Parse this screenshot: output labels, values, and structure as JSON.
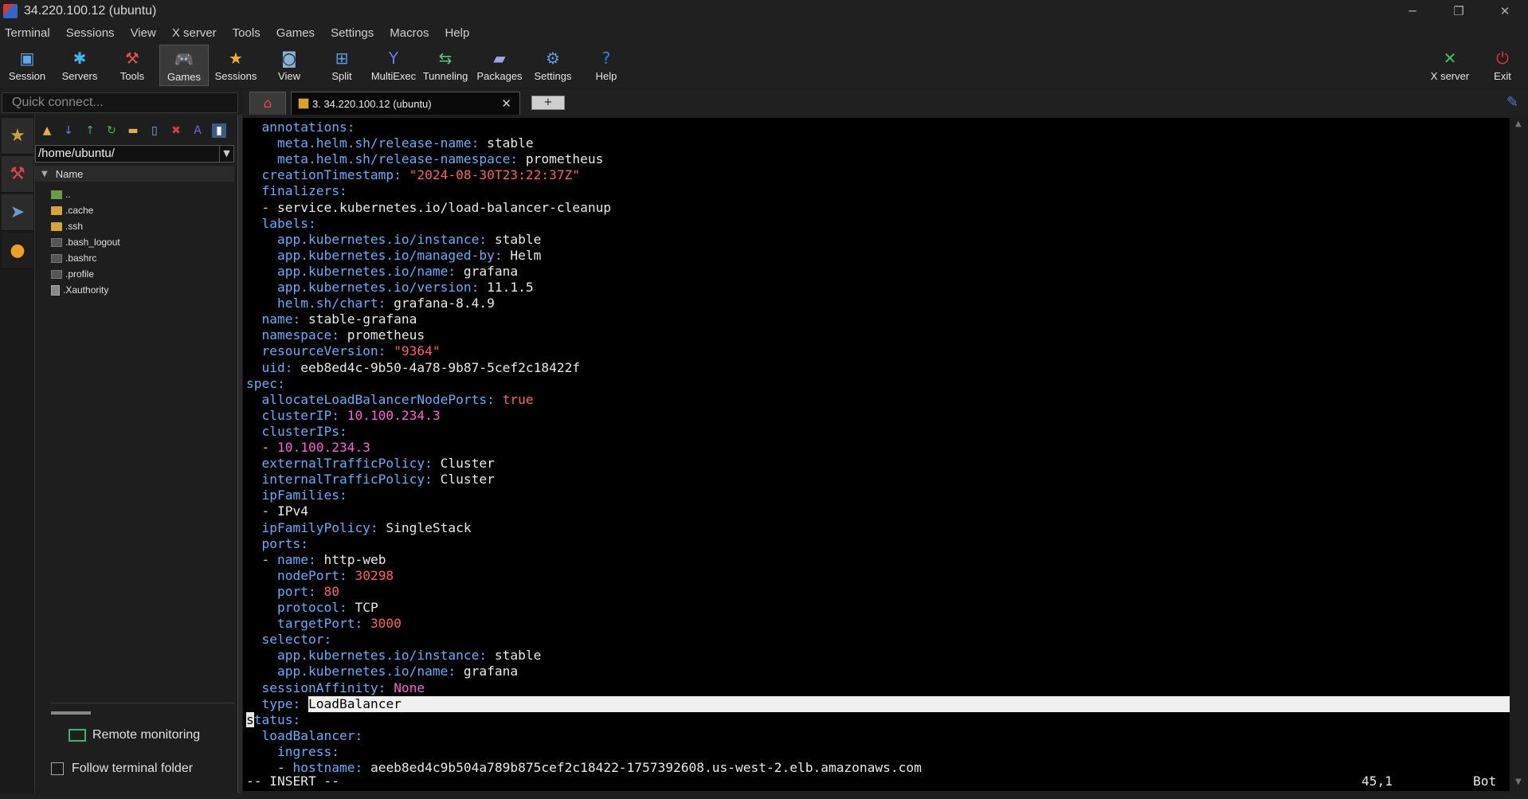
{
  "window": {
    "title": "34.220.100.12 (ubuntu)",
    "minimize_glyph": "─",
    "restore_glyph": "❐",
    "close_glyph": "✕"
  },
  "menu": [
    "Terminal",
    "Sessions",
    "View",
    "X server",
    "Tools",
    "Games",
    "Settings",
    "Macros",
    "Help"
  ],
  "toolbar": {
    "tools": [
      {
        "label": "Session",
        "icon": "session-icon",
        "glyph": "▣",
        "color": "#5fa8e8"
      },
      {
        "label": "Servers",
        "icon": "servers-icon",
        "glyph": "✱",
        "color": "#4ab0e8"
      },
      {
        "label": "Tools",
        "icon": "tools-icon",
        "glyph": "⚒",
        "color": "#e85050"
      },
      {
        "label": "Games",
        "icon": "games-icon",
        "glyph": "🎮",
        "color": "#dddddd"
      },
      {
        "label": "Sessions",
        "icon": "star-icon",
        "glyph": "★",
        "color": "#f0b020"
      },
      {
        "label": "View",
        "icon": "view-icon",
        "glyph": "◙",
        "color": "#8ab0d8"
      },
      {
        "label": "Split",
        "icon": "split-icon",
        "glyph": "⊞",
        "color": "#5a9ae0"
      },
      {
        "label": "MultiExec",
        "icon": "multiexec-icon",
        "glyph": "Y",
        "color": "#6a7ae8"
      },
      {
        "label": "Tunneling",
        "icon": "tunneling-icon",
        "glyph": "⇆",
        "color": "#5ac080"
      },
      {
        "label": "Packages",
        "icon": "packages-icon",
        "glyph": "▰",
        "color": "#9aa8e8"
      },
      {
        "label": "Settings",
        "icon": "gear-icon",
        "glyph": "⚙",
        "color": "#5a9ae0"
      },
      {
        "label": "Help",
        "icon": "help-icon",
        "glyph": "?",
        "color": "#2a8ae8"
      }
    ],
    "right_tools": [
      {
        "label": "X server",
        "icon": "x-server-icon",
        "glyph": "✕",
        "color": "#40c060"
      },
      {
        "label": "Exit",
        "icon": "power-icon",
        "glyph": "⏻",
        "color": "#e83030"
      }
    ]
  },
  "quick_connect": {
    "placeholder": "Quick connect..."
  },
  "tabs": {
    "home_glyph": "⌂",
    "active_label": "3. 34.220.100.12 (ubuntu)",
    "close_glyph": "✕",
    "new_glyph": "+",
    "attach_glyph": "✎"
  },
  "vertical_tabs": [
    {
      "name": "star-icon",
      "glyph": "★",
      "color": "#c8a040"
    },
    {
      "name": "tools-icon",
      "glyph": "⚒",
      "color": "#e04848"
    },
    {
      "name": "send-icon",
      "glyph": "➤",
      "color": "#6a9ac8"
    },
    {
      "name": "sftp-icon",
      "glyph": "●",
      "color": "#f0a020"
    }
  ],
  "sidebar": {
    "toolbar_icons": [
      {
        "name": "folder-up-icon",
        "glyph": "▲",
        "color": "#e0b040"
      },
      {
        "name": "download-icon",
        "glyph": "↓",
        "color": "#4a90d8"
      },
      {
        "name": "upload-icon",
        "glyph": "↑",
        "color": "#40b070"
      },
      {
        "name": "refresh-icon",
        "glyph": "↻",
        "color": "#40c040"
      },
      {
        "name": "new-folder-icon",
        "glyph": "▬",
        "color": "#e0b040"
      },
      {
        "name": "new-file-icon",
        "glyph": "▯",
        "color": "#8ab0e0"
      },
      {
        "name": "delete-icon",
        "glyph": "✖",
        "color": "#d04040"
      },
      {
        "name": "rename-icon",
        "glyph": "A",
        "color": "#6a6ae0"
      },
      {
        "name": "view-toggle-icon",
        "glyph": "▮",
        "color": "#ffffff"
      }
    ],
    "path": "/home/ubuntu/",
    "column_header": "Name",
    "files": [
      {
        "name": "..",
        "kind": "up"
      },
      {
        "name": ".cache",
        "kind": "folder"
      },
      {
        "name": ".ssh",
        "kind": "folder"
      },
      {
        "name": ".bash_logout",
        "kind": "file"
      },
      {
        "name": ".bashrc",
        "kind": "file"
      },
      {
        "name": ".profile",
        "kind": "file"
      },
      {
        "name": ".Xauthority",
        "kind": "doc"
      }
    ],
    "remote_monitoring": "Remote monitoring",
    "follow_terminal": "Follow terminal folder"
  },
  "terminal": {
    "lines": [
      [
        [
          "k",
          "  annotations:"
        ]
      ],
      [
        [
          "k",
          "    meta.helm.sh/release-name:"
        ],
        [
          "v",
          " stable"
        ]
      ],
      [
        [
          "k",
          "    meta.helm.sh/release-namespace:"
        ],
        [
          "v",
          " prometheus"
        ]
      ],
      [
        [
          "k",
          "  creationTimestamp:"
        ],
        [
          "v",
          " "
        ],
        [
          "s",
          "\"2024-08-30T23:22:37Z\""
        ]
      ],
      [
        [
          "k",
          "  finalizers:"
        ]
      ],
      [
        [
          "dash",
          "  -"
        ],
        [
          "v",
          " service.kubernetes.io/load-balancer-cleanup"
        ]
      ],
      [
        [
          "k",
          "  labels:"
        ]
      ],
      [
        [
          "k",
          "    app.kubernetes.io/instance:"
        ],
        [
          "v",
          " stable"
        ]
      ],
      [
        [
          "k",
          "    app.kubernetes.io/managed-by:"
        ],
        [
          "v",
          " Helm"
        ]
      ],
      [
        [
          "k",
          "    app.kubernetes.io/name:"
        ],
        [
          "v",
          " grafana"
        ]
      ],
      [
        [
          "k",
          "    app.kubernetes.io/version:"
        ],
        [
          "v",
          " 11.1.5"
        ]
      ],
      [
        [
          "k",
          "    helm.sh/chart:"
        ],
        [
          "v",
          " grafana-8.4.9"
        ]
      ],
      [
        [
          "k",
          "  name:"
        ],
        [
          "v",
          " stable-grafana"
        ]
      ],
      [
        [
          "k",
          "  namespace:"
        ],
        [
          "v",
          " prometheus"
        ]
      ],
      [
        [
          "k",
          "  resourceVersion:"
        ],
        [
          "v",
          " "
        ],
        [
          "s",
          "\"9364\""
        ]
      ],
      [
        [
          "k",
          "  uid:"
        ],
        [
          "v",
          " eeb8ed4c-9b50-4a78-9b87-5cef2c18422f"
        ]
      ],
      [
        [
          "k",
          "spec:"
        ]
      ],
      [
        [
          "k",
          "  allocateLoadBalancerNodePorts:"
        ],
        [
          "v",
          " "
        ],
        [
          "s",
          "true"
        ]
      ],
      [
        [
          "k",
          "  clusterIP:"
        ],
        [
          "v",
          " "
        ],
        [
          "n",
          "10.100.234.3"
        ]
      ],
      [
        [
          "k",
          "  clusterIPs:"
        ]
      ],
      [
        [
          "dash",
          "  -"
        ],
        [
          "v",
          " "
        ],
        [
          "n",
          "10.100.234.3"
        ]
      ],
      [
        [
          "k",
          "  externalTrafficPolicy:"
        ],
        [
          "v",
          " Cluster"
        ]
      ],
      [
        [
          "k",
          "  internalTrafficPolicy:"
        ],
        [
          "v",
          " Cluster"
        ]
      ],
      [
        [
          "k",
          "  ipFamilies:"
        ]
      ],
      [
        [
          "dash",
          "  -"
        ],
        [
          "v",
          " IPv4"
        ]
      ],
      [
        [
          "k",
          "  ipFamilyPolicy:"
        ],
        [
          "v",
          " SingleStack"
        ]
      ],
      [
        [
          "k",
          "  ports:"
        ]
      ],
      [
        [
          "dash",
          "  -"
        ],
        [
          "k",
          " name:"
        ],
        [
          "v",
          " http-web"
        ]
      ],
      [
        [
          "k",
          "    nodePort:"
        ],
        [
          "v",
          " "
        ],
        [
          "s",
          "30298"
        ]
      ],
      [
        [
          "k",
          "    port:"
        ],
        [
          "v",
          " "
        ],
        [
          "s",
          "80"
        ]
      ],
      [
        [
          "k",
          "    protocol:"
        ],
        [
          "v",
          " TCP"
        ]
      ],
      [
        [
          "k",
          "    targetPort:"
        ],
        [
          "v",
          " "
        ],
        [
          "s",
          "3000"
        ]
      ],
      [
        [
          "k",
          "  selector:"
        ]
      ],
      [
        [
          "k",
          "    app.kubernetes.io/instance:"
        ],
        [
          "v",
          " stable"
        ]
      ],
      [
        [
          "k",
          "    app.kubernetes.io/name:"
        ],
        [
          "v",
          " grafana"
        ]
      ],
      [
        [
          "k",
          "  sessionAffinity:"
        ],
        [
          "v",
          " "
        ],
        [
          "n",
          "None"
        ]
      ],
      [
        [
          "k",
          "  type:"
        ],
        [
          "v",
          " "
        ],
        [
          "hl",
          "LoadBalancer"
        ]
      ],
      [
        [
          "cursor",
          "s"
        ],
        [
          "k",
          "tatus:"
        ]
      ],
      [
        [
          "k",
          "  loadBalancer:"
        ]
      ],
      [
        [
          "k",
          "    ingress:"
        ]
      ],
      [
        [
          "dash",
          "    -"
        ],
        [
          "k",
          " hostname:"
        ],
        [
          "v",
          " aeeb8ed4c9b504a789b875cef2c18422-1757392608.us-west-2.elb.amazonaws.com"
        ]
      ]
    ],
    "mode": "-- INSERT --",
    "position": "45,1",
    "scroll": "Bot"
  },
  "scrollbar": {
    "up_glyph": "▲",
    "down_glyph": "▼"
  }
}
